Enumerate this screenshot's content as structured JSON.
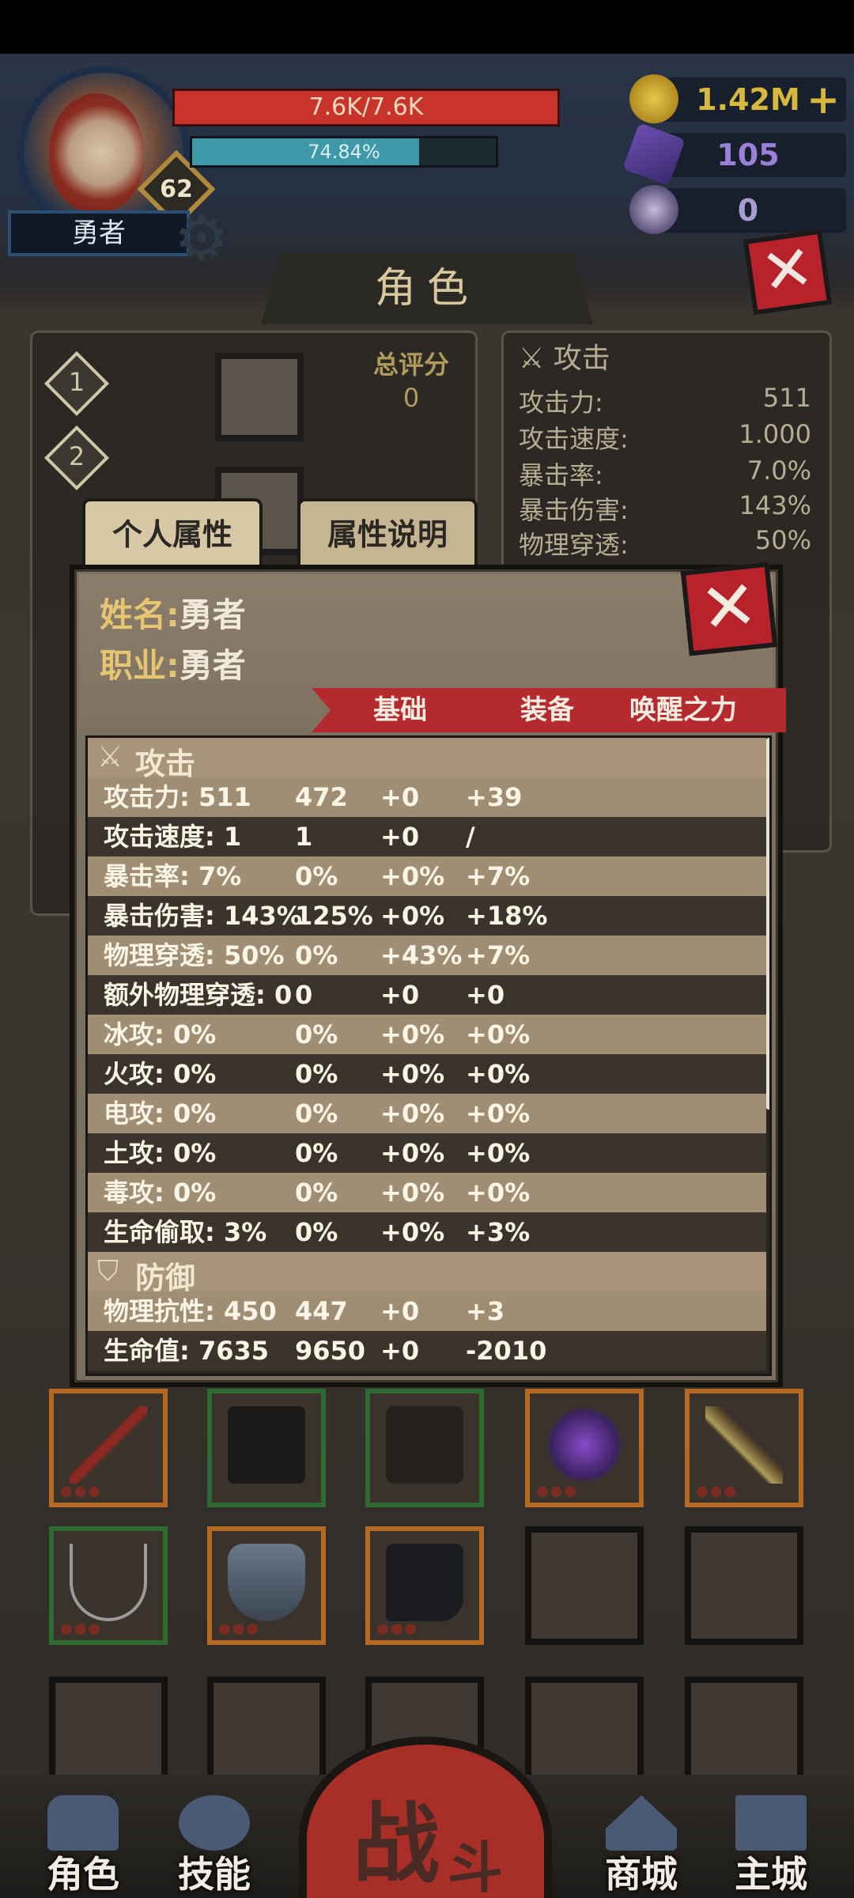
{
  "hud": {
    "hp_text": "7.6K/7.6K",
    "hp_fraction": 1.0,
    "xp_text": "74.84%",
    "xp_fraction": 0.7484,
    "level": "62",
    "player_name": "勇者",
    "gold": "1.42M",
    "gems": "105",
    "relics": "0",
    "gold_color": "#d6b93c",
    "gem_color": "#8a6cc4",
    "relic_color": "#b0a8d8"
  },
  "page_title": "角色",
  "overview": {
    "slot_1": "1",
    "slot_2": "2",
    "score_label": "总评分",
    "score_value": "0",
    "attack_header": "攻击",
    "attack_stats": [
      {
        "label": "攻击力:",
        "value": "511"
      },
      {
        "label": "攻击速度:",
        "value": "1.000"
      },
      {
        "label": "暴击率:",
        "value": "7.0%"
      },
      {
        "label": "暴击伤害:",
        "value": "143%"
      },
      {
        "label": "物理穿透:",
        "value": "50%"
      }
    ]
  },
  "tabs": {
    "personal": "个人属性",
    "explain": "属性说明"
  },
  "modal": {
    "name_label": "姓名:",
    "name_value": "勇者",
    "job_label": "职业:",
    "job_value": "勇者",
    "col_base": "基础",
    "col_equip": "装备",
    "col_awaken": "唤醒之力",
    "attack_section": "攻击",
    "defense_section": "防御",
    "attack_rows": [
      {
        "stat": "攻击力: 511",
        "base": "472",
        "equip": "+0",
        "awaken": "+39"
      },
      {
        "stat": "攻击速度: 1",
        "base": "1",
        "equip": "+0",
        "awaken": "/"
      },
      {
        "stat": "暴击率: 7%",
        "base": "0%",
        "equip": "+0%",
        "awaken": "+7%"
      },
      {
        "stat": "暴击伤害: 143%",
        "base": "125%",
        "equip": "+0%",
        "awaken": "+18%"
      },
      {
        "stat": "物理穿透: 50%",
        "base": "0%",
        "equip": "+43%",
        "awaken": "+7%"
      },
      {
        "stat": "额外物理穿透: 0",
        "base": "0",
        "equip": "+0",
        "awaken": "+0"
      },
      {
        "stat": "冰攻: 0%",
        "base": "0%",
        "equip": "+0%",
        "awaken": "+0%"
      },
      {
        "stat": "火攻: 0%",
        "base": "0%",
        "equip": "+0%",
        "awaken": "+0%"
      },
      {
        "stat": "电攻: 0%",
        "base": "0%",
        "equip": "+0%",
        "awaken": "+0%"
      },
      {
        "stat": "土攻: 0%",
        "base": "0%",
        "equip": "+0%",
        "awaken": "+0%"
      },
      {
        "stat": "毒攻: 0%",
        "base": "0%",
        "equip": "+0%",
        "awaken": "+0%"
      },
      {
        "stat": "生命偷取: 3%",
        "base": "0%",
        "equip": "+0%",
        "awaken": "+3%"
      }
    ],
    "defense_rows": [
      {
        "stat": "物理抗性: 450",
        "base": "447",
        "equip": "+0",
        "awaken": "+3"
      },
      {
        "stat": "生命值: 7635",
        "base": "9650",
        "equip": "+0",
        "awaken": "-2010"
      }
    ]
  },
  "items": {
    "row1": [
      "staff-icon",
      "pants-icon",
      "robe-icon",
      "mask-icon",
      "sword-icon"
    ],
    "row2": [
      "necklace-icon",
      "shield-icon",
      "boots-icon",
      "empty",
      "empty"
    ]
  },
  "nav": {
    "role": "角色",
    "skill": "技能",
    "battle_a": "战",
    "battle_b": "斗",
    "shop": "商城",
    "city": "主城"
  }
}
